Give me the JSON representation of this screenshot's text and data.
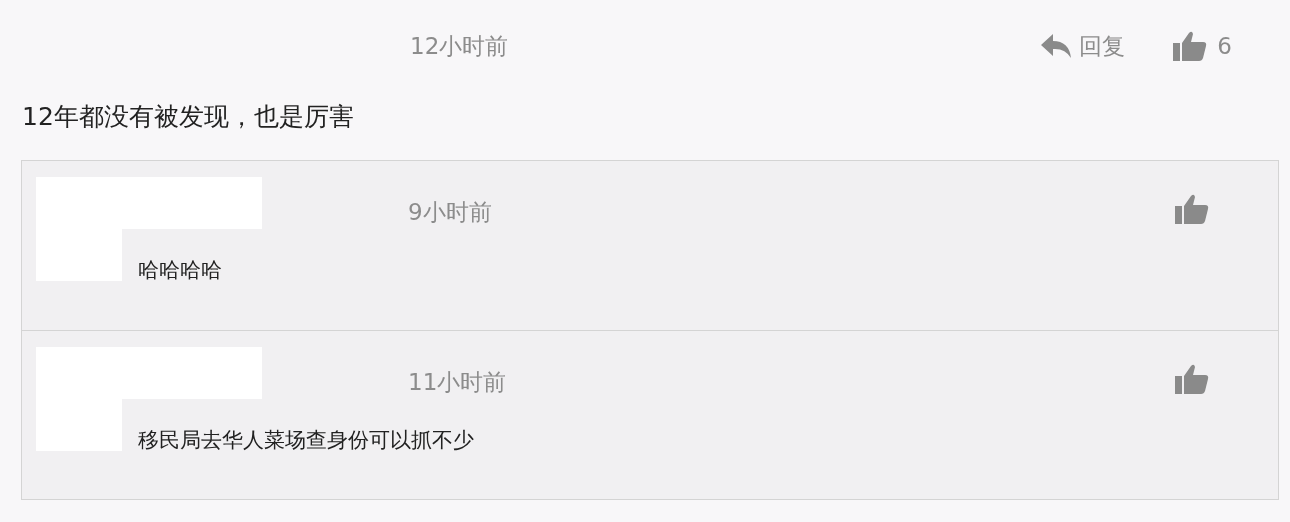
{
  "comment": {
    "time": "12小时前",
    "reply_label": "回复",
    "like_count": "6",
    "text": "12年都没有被发现，也是厉害"
  },
  "replies": [
    {
      "time": "9小时前",
      "text": "哈哈哈哈"
    },
    {
      "time": "11小时前",
      "text": "移民局去华人菜场查身份可以抓不少"
    }
  ]
}
